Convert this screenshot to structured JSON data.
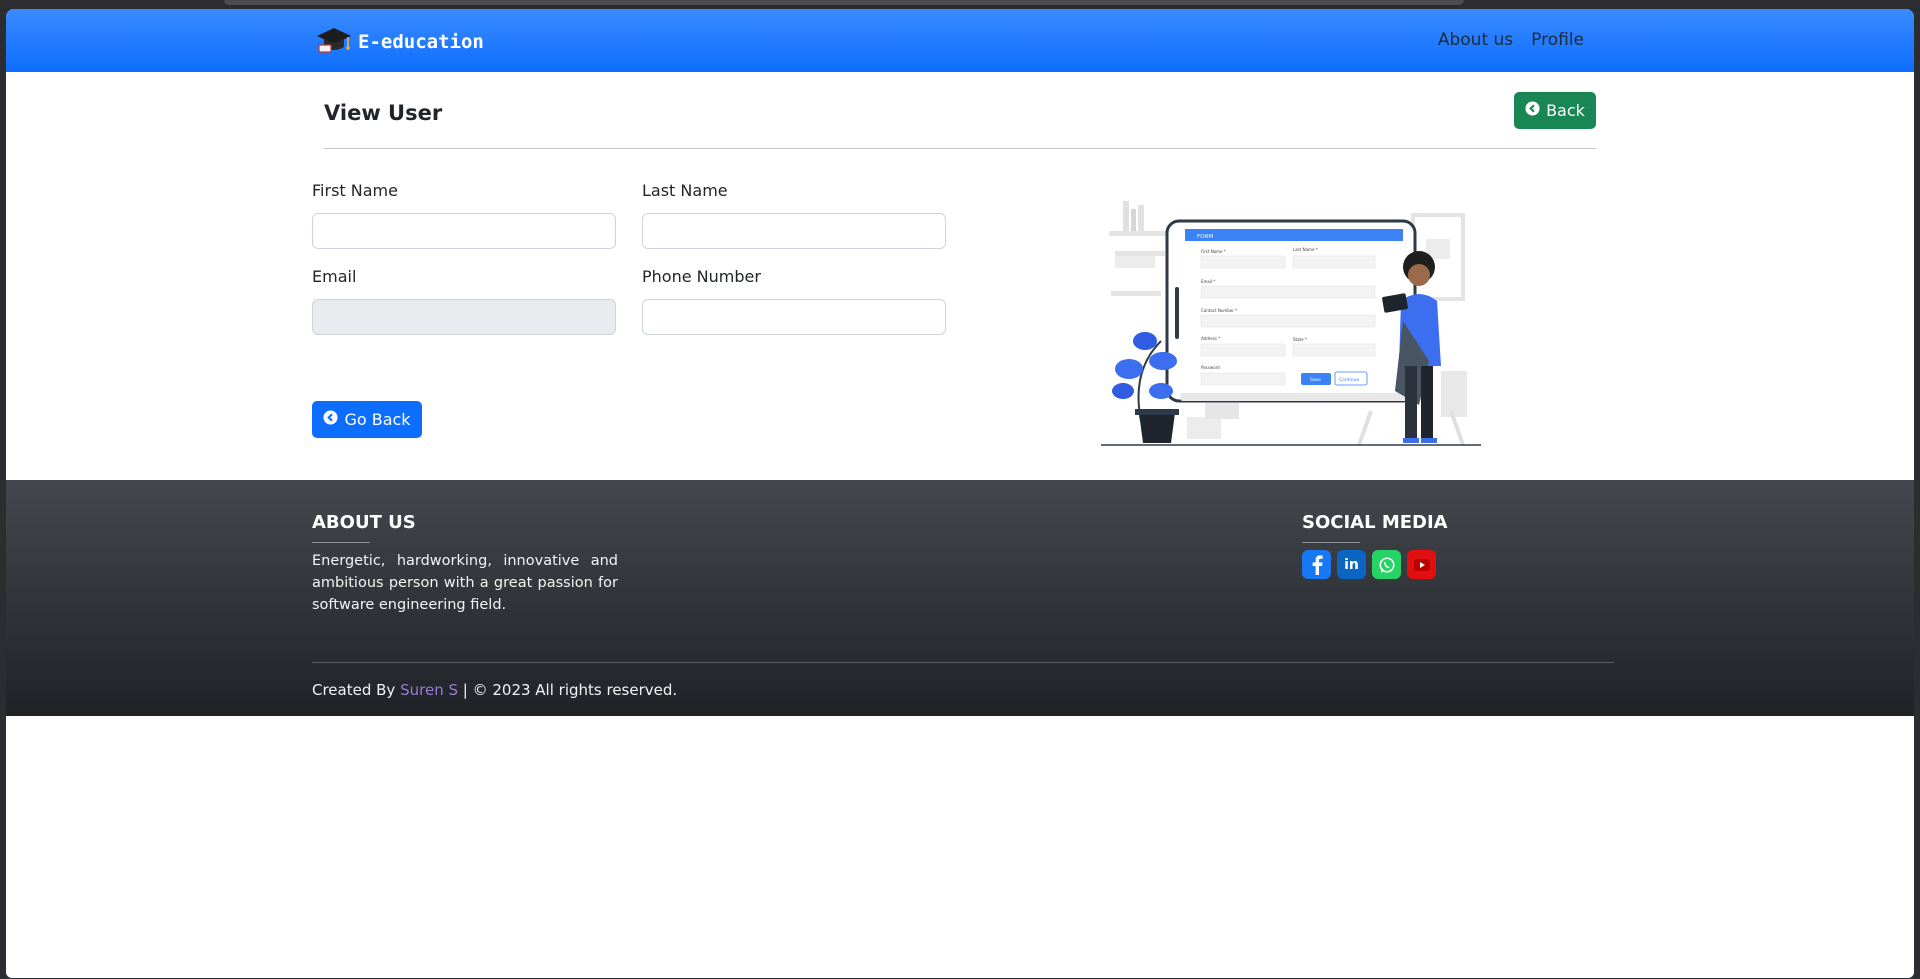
{
  "navbar": {
    "brand": "E-education",
    "links": [
      "About us",
      "Profile"
    ]
  },
  "header": {
    "title": "View User",
    "back_label": "Back"
  },
  "form": {
    "first_name": {
      "label": "First Name",
      "value": ""
    },
    "last_name": {
      "label": "Last Name",
      "value": ""
    },
    "email": {
      "label": "Email",
      "value": ""
    },
    "phone": {
      "label": "Phone Number",
      "value": ""
    },
    "go_back_label": "Go Back"
  },
  "illustration": {
    "form_header": "FORM",
    "fields": [
      "First Name *",
      "Last Name *",
      "Email *",
      "Contact Number *",
      "Address *",
      "State *",
      "Password"
    ],
    "save_label": "Save",
    "continue_label": "Continue"
  },
  "footer": {
    "about_heading": "ABOUT US",
    "about_text": "Energetic, hardworking, innovative and ambitious person with a great passion for software engineering field.",
    "social_heading": "SOCIAL MEDIA",
    "social_icons": [
      "facebook-icon",
      "linkedin-icon",
      "whatsapp-icon",
      "youtube-icon"
    ],
    "credit_prefix": "Created By",
    "credit_author": "Suren S",
    "credit_suffix": "| © 2023 All rights reserved."
  },
  "colors": {
    "navbar": "#0d6efd",
    "back_button": "#198754",
    "primary": "#0d6efd",
    "footer": "#2b2e33",
    "facebook": "#1877f2",
    "linkedin": "#0a66c2",
    "whatsapp": "#25d366",
    "youtube": "#e10f0f"
  }
}
